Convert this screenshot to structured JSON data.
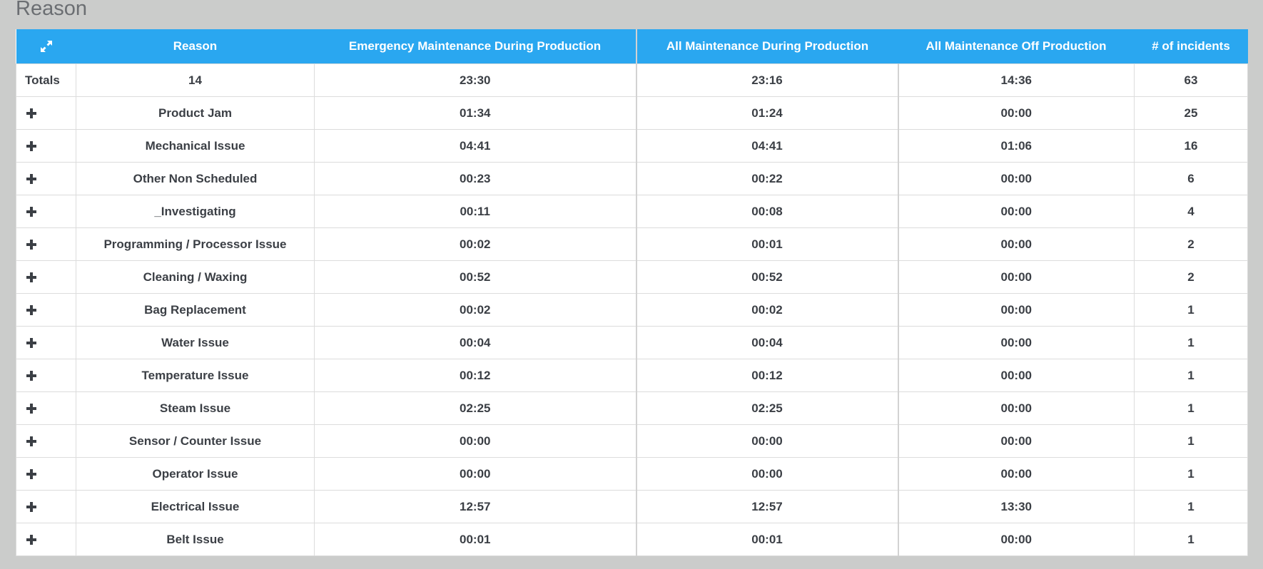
{
  "page": {
    "title": "Reason"
  },
  "table": {
    "headers": [
      "Reason",
      "Emergency Maintenance During Production",
      "All Maintenance During Production",
      "All Maintenance Off Production",
      "# of incidents"
    ],
    "totals": {
      "label": "Totals",
      "reason": "14",
      "emergency": "23:30",
      "during": "23:16",
      "off": "14:36",
      "incidents": "63"
    },
    "rows": [
      {
        "reason": "Product Jam",
        "emergency": "01:34",
        "during": "01:24",
        "off": "00:00",
        "incidents": "25"
      },
      {
        "reason": "Mechanical Issue",
        "emergency": "04:41",
        "during": "04:41",
        "off": "01:06",
        "incidents": "16"
      },
      {
        "reason": "Other Non Scheduled",
        "emergency": "00:23",
        "during": "00:22",
        "off": "00:00",
        "incidents": "6"
      },
      {
        "reason": "_Investigating",
        "emergency": "00:11",
        "during": "00:08",
        "off": "00:00",
        "incidents": "4"
      },
      {
        "reason": "Programming / Processor Issue",
        "emergency": "00:02",
        "during": "00:01",
        "off": "00:00",
        "incidents": "2"
      },
      {
        "reason": "Cleaning / Waxing",
        "emergency": "00:52",
        "during": "00:52",
        "off": "00:00",
        "incidents": "2"
      },
      {
        "reason": "Bag Replacement",
        "emergency": "00:02",
        "during": "00:02",
        "off": "00:00",
        "incidents": "1"
      },
      {
        "reason": "Water Issue",
        "emergency": "00:04",
        "during": "00:04",
        "off": "00:00",
        "incidents": "1"
      },
      {
        "reason": "Temperature Issue",
        "emergency": "00:12",
        "during": "00:12",
        "off": "00:00",
        "incidents": "1"
      },
      {
        "reason": "Steam Issue",
        "emergency": "02:25",
        "during": "02:25",
        "off": "00:00",
        "incidents": "1"
      },
      {
        "reason": "Sensor / Counter Issue",
        "emergency": "00:00",
        "during": "00:00",
        "off": "00:00",
        "incidents": "1"
      },
      {
        "reason": "Operator Issue",
        "emergency": "00:00",
        "during": "00:00",
        "off": "00:00",
        "incidents": "1"
      },
      {
        "reason": "Electrical Issue",
        "emergency": "12:57",
        "during": "12:57",
        "off": "13:30",
        "incidents": "1"
      },
      {
        "reason": "Belt Issue",
        "emergency": "00:01",
        "during": "00:01",
        "off": "00:00",
        "incidents": "1"
      }
    ]
  },
  "icons": {
    "expand": "expand-icon",
    "row_toggle": "plus-icon"
  },
  "colors": {
    "header_bg": "#2aa7f0",
    "page_bg": "#cbcccb"
  }
}
